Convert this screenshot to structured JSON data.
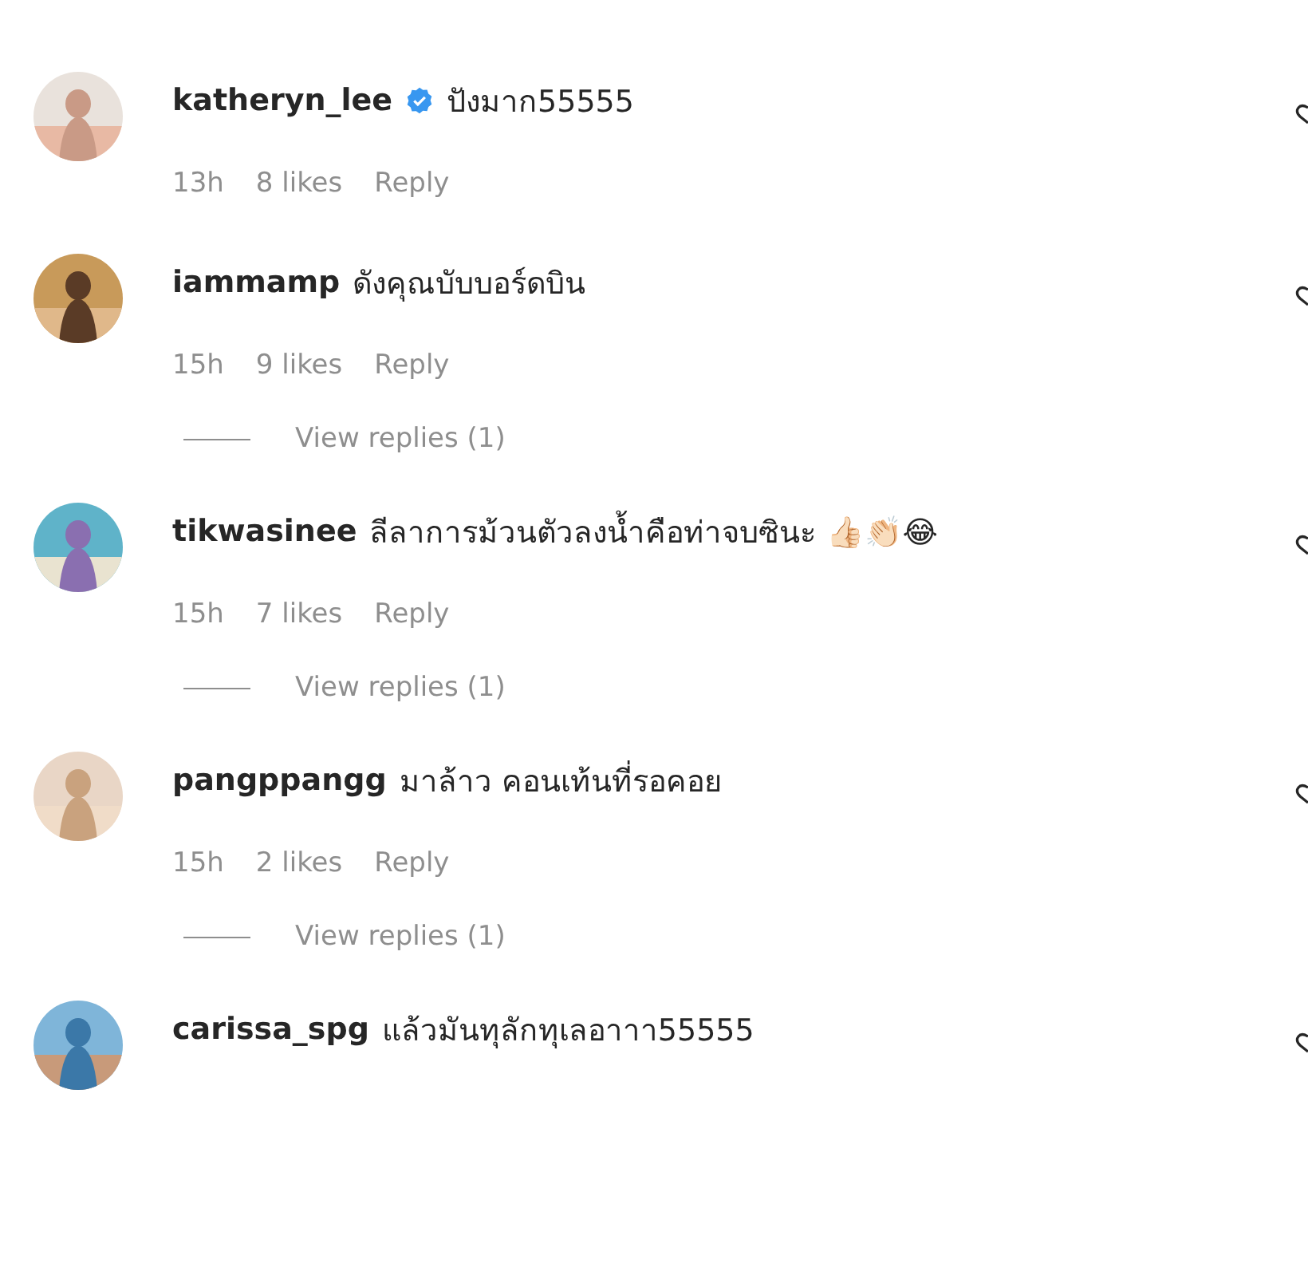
{
  "comments": [
    {
      "username": "katheryn_lee",
      "verified": true,
      "text": "ปังมาก55555",
      "time": "13h",
      "likes": "8 likes",
      "reply": "Reply"
    },
    {
      "username": "iammamp",
      "verified": false,
      "text": "ดังคุณบับบอร์ดบิน",
      "time": "15h",
      "likes": "9 likes",
      "reply": "Reply",
      "view_replies": "View replies (1)"
    },
    {
      "username": "tikwasinee",
      "verified": false,
      "text": "ลีลาการม้วนตัวลงน้ำคือท่าจบซินะ 👍🏻👏🏻😂",
      "time": "15h",
      "likes": "7 likes",
      "reply": "Reply",
      "view_replies": "View replies (1)"
    },
    {
      "username": "pangppangg",
      "verified": false,
      "text": "มาล้าว คอนเท้นที่รอคอย",
      "time": "15h",
      "likes": "2 likes",
      "reply": "Reply",
      "view_replies": "View replies (1)"
    },
    {
      "username": "carissa_spg",
      "verified": false,
      "text": "แล้วมันทุลักทุเลอาาา55555"
    }
  ]
}
